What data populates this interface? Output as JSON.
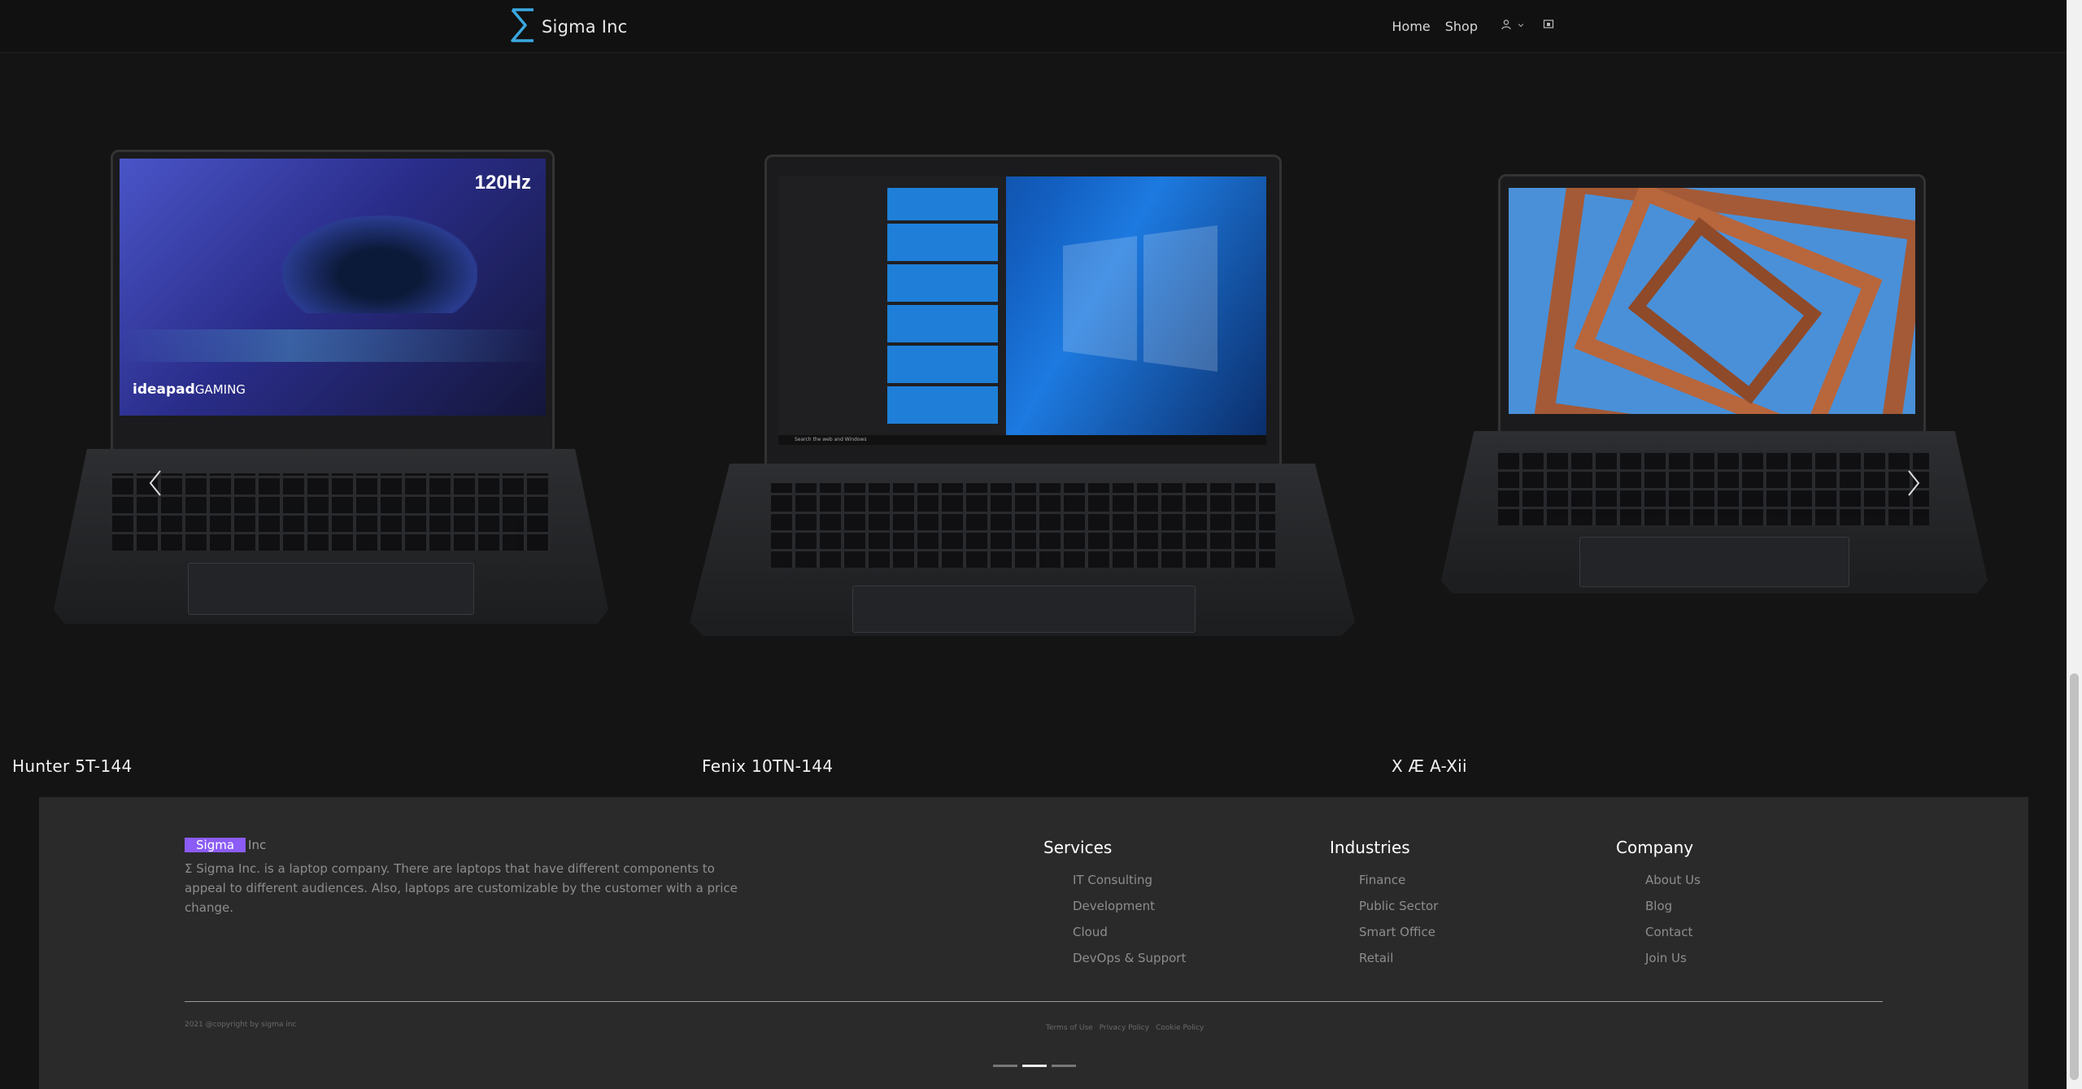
{
  "navbar": {
    "brand": "Sigma Inc",
    "links": [
      "Home",
      "Shop"
    ],
    "user_icon": "user-icon",
    "caret_icon": "chevron-down-icon",
    "extra_icon": "display-icon"
  },
  "carousel": {
    "prev_icon": "chevron-left-icon",
    "next_icon": "chevron-right-icon",
    "products": [
      {
        "name": "Hunter 5T-144",
        "screen_text": "120Hz",
        "screen_brand": "ideapad",
        "screen_brand2": "GAMING"
      },
      {
        "name": "Fenix 10TN-144",
        "search_placeholder": "Search the web and Windows"
      },
      {
        "name": "X Æ A-Xii"
      }
    ],
    "active_indicator": 2,
    "indicator_count": 3
  },
  "footer": {
    "logo_highlight": "Sigma",
    "logo_rest": "Inc",
    "description": "Σ Sigma Inc. is a laptop company. There are laptops that have different components to appeal to different audiences. Also, laptops are customizable by the customer with a price change.",
    "columns": [
      {
        "title": "Services",
        "items": [
          "IT Consulting",
          "Development",
          "Cloud",
          "DevOps & Support"
        ]
      },
      {
        "title": "Industries",
        "items": [
          "Finance",
          "Public Sector",
          "Smart Office",
          "Retail"
        ]
      },
      {
        "title": "Company",
        "items": [
          "About Us",
          "Blog",
          "Contact",
          "Join Us"
        ]
      }
    ],
    "copyright": "2021 @copyright by sigma inc",
    "legal": [
      "Terms of Use",
      "Privacy Policy",
      "Cookie Policy"
    ]
  },
  "colors": {
    "page_bg": "#141414",
    "footer_bg": "#2a2a2a",
    "logo_highlight": "#8b5cf6",
    "brand_icon": "#3aa8e0"
  }
}
